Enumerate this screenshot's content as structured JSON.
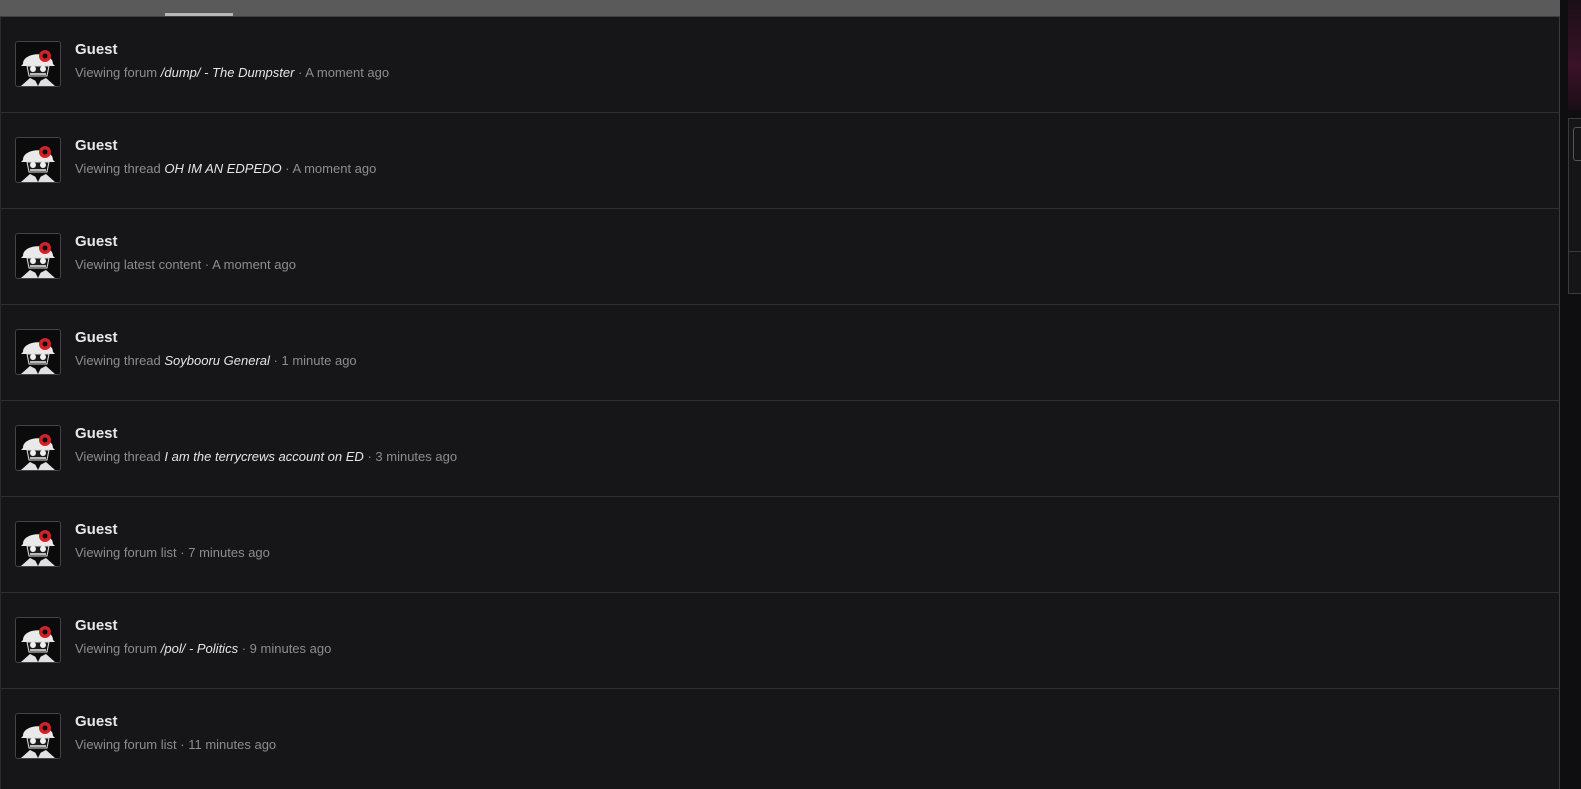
{
  "online": {
    "entries": [
      {
        "user": "Guest",
        "action": "Viewing forum",
        "target": "/dump/ - The Dumpster",
        "time": "A moment ago"
      },
      {
        "user": "Guest",
        "action": "Viewing thread",
        "target": "OH IM AN EDPEDO",
        "time": "A moment ago"
      },
      {
        "user": "Guest",
        "action": "Viewing latest content",
        "target": "",
        "time": "A moment ago"
      },
      {
        "user": "Guest",
        "action": "Viewing thread",
        "target": "Soybooru General",
        "time": "1 minute ago"
      },
      {
        "user": "Guest",
        "action": "Viewing thread",
        "target": "I am the terrycrews account on ED",
        "time": "3 minutes ago"
      },
      {
        "user": "Guest",
        "action": "Viewing forum list",
        "target": "",
        "time": "7 minutes ago"
      },
      {
        "user": "Guest",
        "action": "Viewing forum",
        "target": "/pol/ - Politics",
        "time": "9 minutes ago"
      },
      {
        "user": "Guest",
        "action": "Viewing forum list",
        "target": "",
        "time": "11 minutes ago"
      }
    ],
    "separator": "·"
  },
  "icons": {
    "avatar": "guest-avatar-helmet-skull-icon"
  },
  "colors": {
    "background": "#161517",
    "row_border": "#2f2e30",
    "username": "#e8e8e8",
    "muted_text": "#8d8d8d",
    "link_text": "#e6e6e6",
    "tabbar": "#5a5a5a",
    "tab_indicator": "#b8b8b8",
    "avatar_accent": "#d31f2a"
  }
}
